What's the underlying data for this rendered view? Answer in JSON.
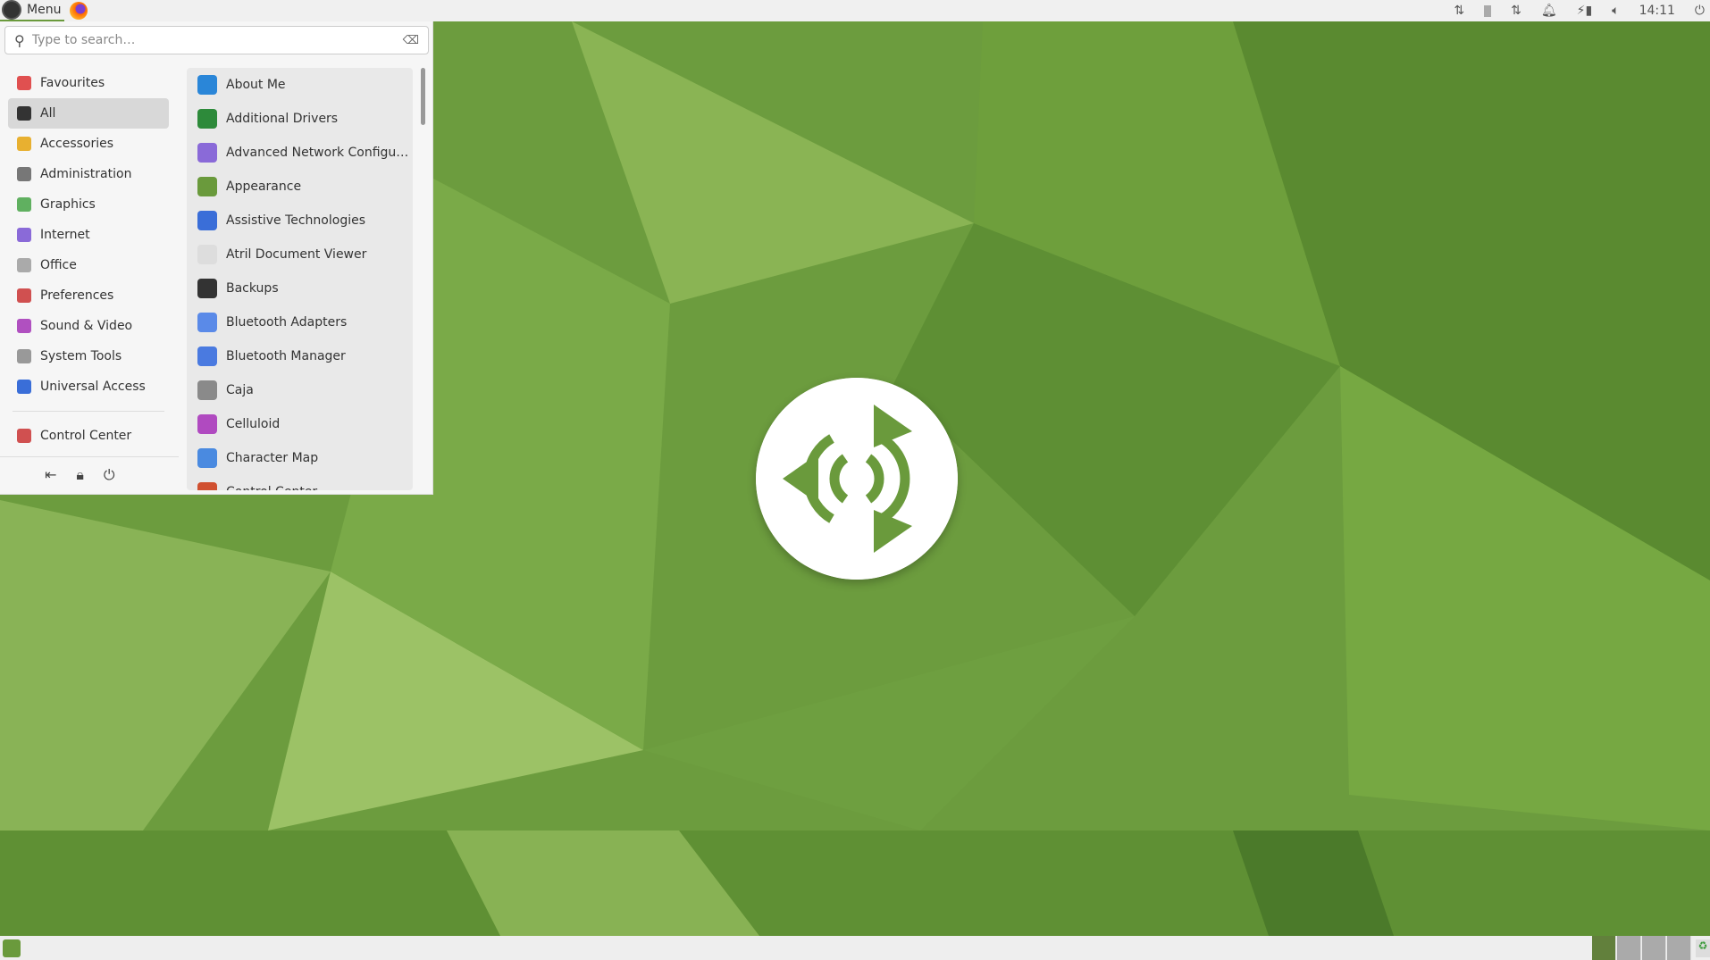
{
  "topbar": {
    "menu_label": "Menu",
    "clock": "14:11",
    "tray_icons": [
      "network-icon",
      "battery-indicator-icon",
      "network-transfer-icon",
      "notification-bell-icon",
      "power-battery-icon",
      "volume-icon"
    ]
  },
  "menu": {
    "search_placeholder": "Type to search…",
    "categories": [
      {
        "label": "Favourites",
        "icon": "heart-icon",
        "color": "#e05050"
      },
      {
        "label": "All",
        "icon": "star-icon",
        "color": "#333333",
        "selected": true
      },
      {
        "label": "Accessories",
        "icon": "accessories-icon",
        "color": "#e8b030"
      },
      {
        "label": "Administration",
        "icon": "administration-icon",
        "color": "#777777"
      },
      {
        "label": "Graphics",
        "icon": "graphics-icon",
        "color": "#60b060"
      },
      {
        "label": "Internet",
        "icon": "internet-icon",
        "color": "#8a6ad8"
      },
      {
        "label": "Office",
        "icon": "office-icon",
        "color": "#aaaaaa"
      },
      {
        "label": "Preferences",
        "icon": "preferences-icon",
        "color": "#d05050"
      },
      {
        "label": "Sound & Video",
        "icon": "sound-video-icon",
        "color": "#b050c0"
      },
      {
        "label": "System Tools",
        "icon": "system-tools-icon",
        "color": "#999999"
      },
      {
        "label": "Universal Access",
        "icon": "universal-access-icon",
        "color": "#3a6ed8"
      }
    ],
    "control_center": "Control Center",
    "apps": [
      {
        "label": "About Me",
        "color": "#2a86d8"
      },
      {
        "label": "Additional Drivers",
        "color": "#2d8a3a"
      },
      {
        "label": "Advanced Network Configu…",
        "color": "#8a6ad8"
      },
      {
        "label": "Appearance",
        "color": "#6a9a3c"
      },
      {
        "label": "Assistive Technologies",
        "color": "#3a6ed8"
      },
      {
        "label": "Atril Document Viewer",
        "color": "#dddddd"
      },
      {
        "label": "Backups",
        "color": "#333333"
      },
      {
        "label": "Bluetooth Adapters",
        "color": "#5a8ae8"
      },
      {
        "label": "Bluetooth Manager",
        "color": "#4a7ae0"
      },
      {
        "label": "Caja",
        "color": "#8a8a8a"
      },
      {
        "label": "Celluloid",
        "color": "#b04ac0"
      },
      {
        "label": "Character Map",
        "color": "#4a8ae0"
      },
      {
        "label": "Control Center",
        "color": "#d05030"
      }
    ]
  }
}
